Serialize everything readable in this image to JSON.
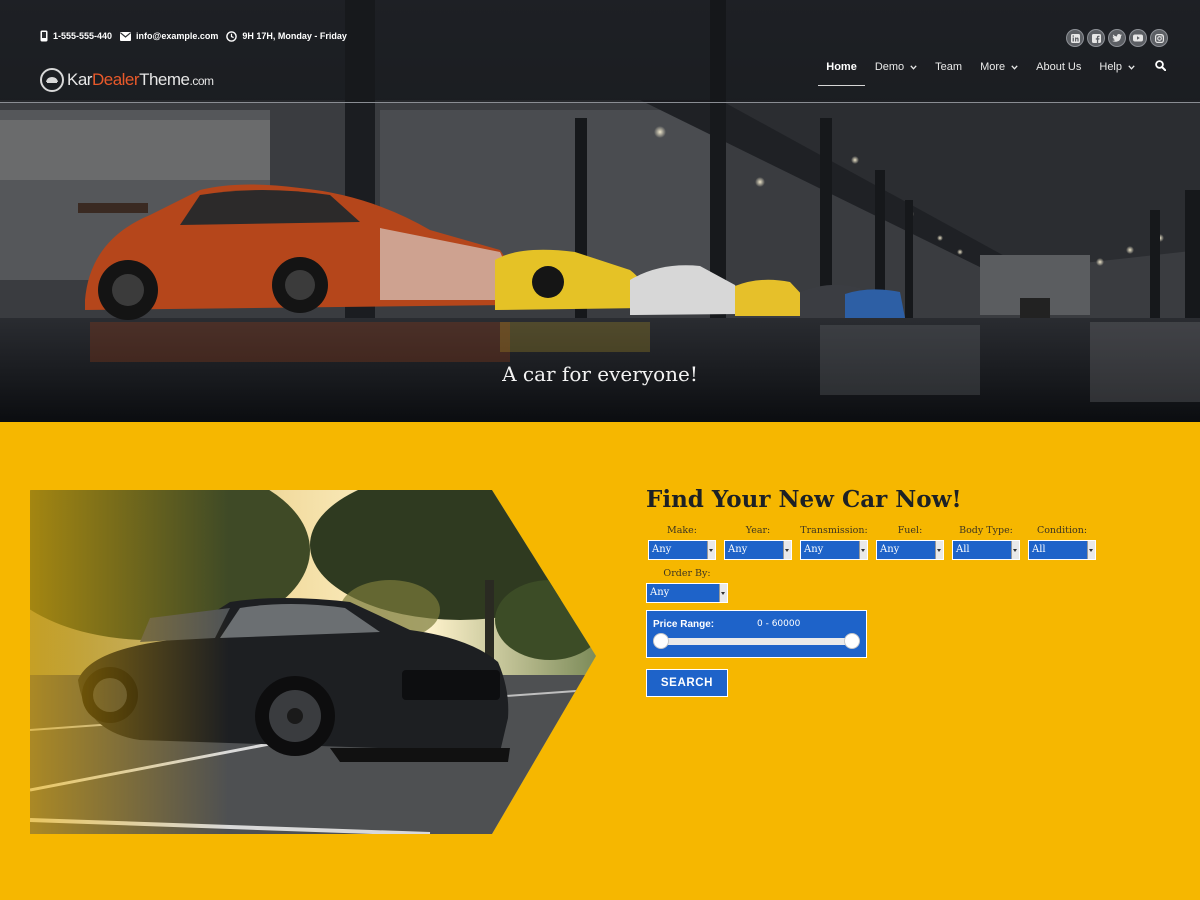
{
  "header": {
    "phone": "1-555-555-440",
    "email": "info@example.com",
    "hours": "9H 17H, Monday - Friday",
    "logo": {
      "part1": "Kar",
      "part2": "Dealer",
      "part3": "Theme",
      "tld": ".com"
    },
    "social_icons": [
      "linkedin-icon",
      "facebook-icon",
      "twitter-icon",
      "youtube-icon",
      "instagram-icon"
    ],
    "nav": {
      "home": "Home",
      "demo": "Demo",
      "team": "Team",
      "more": "More",
      "about": "About Us",
      "help": "Help"
    }
  },
  "hero": {
    "tagline": "A car for everyone!"
  },
  "finder": {
    "title": "Find Your New Car Now!",
    "filters": [
      {
        "label": "Make:",
        "value": "Any"
      },
      {
        "label": "Year:",
        "value": "Any"
      },
      {
        "label": "Transmission:",
        "value": "Any"
      },
      {
        "label": "Fuel:",
        "value": "Any"
      },
      {
        "label": "Body Type:",
        "value": "All"
      },
      {
        "label": "Condition:",
        "value": "All"
      }
    ],
    "order_by": {
      "label": "Order By:",
      "value": "Any"
    },
    "price": {
      "label": "Price Range:",
      "value": "0 - 60000",
      "min": 0,
      "max": 60000
    },
    "search_label": "SEARCH"
  },
  "colors": {
    "accent_yellow": "#f6b700",
    "button_blue": "#1e63c9",
    "logo_accent": "#e8592a"
  }
}
